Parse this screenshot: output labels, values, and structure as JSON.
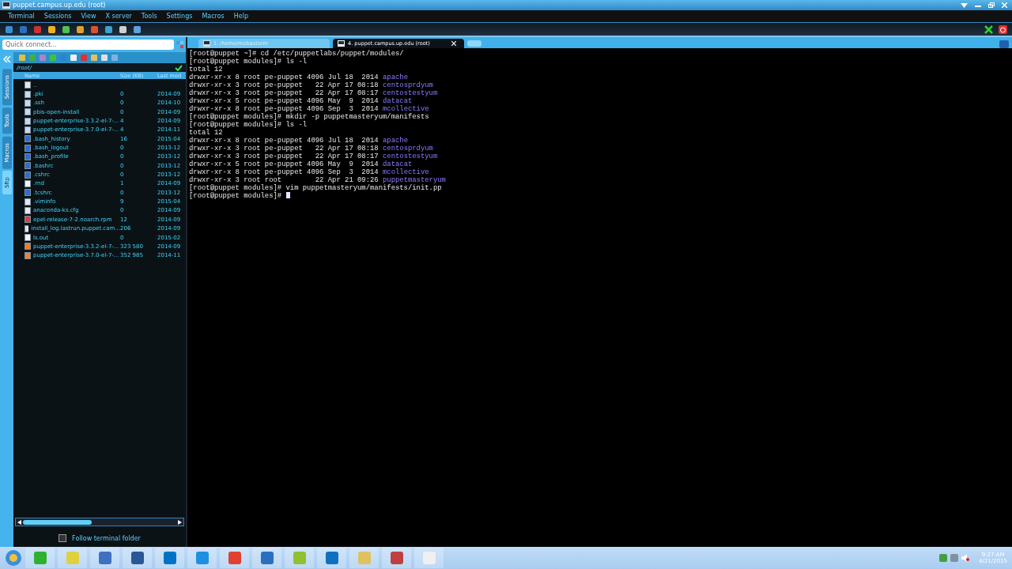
{
  "window": {
    "title": "puppet.campus.up.edu (root)"
  },
  "menu": [
    "Terminal",
    "Sessions",
    "View",
    "X server",
    "Tools",
    "Settings",
    "Macros",
    "Help"
  ],
  "quick_connect": {
    "placeholder": "Quick connect..."
  },
  "side_tabs": [
    {
      "label": "Sessions",
      "selected": false
    },
    {
      "label": "Tools",
      "selected": false
    },
    {
      "label": "Macros",
      "selected": false
    },
    {
      "label": "Sftp",
      "selected": true
    }
  ],
  "file_browser": {
    "path": "/root/",
    "columns": [
      "Name",
      "Size (KB)",
      "Last mod"
    ],
    "rows": [
      {
        "kind": "up",
        "name": "..",
        "size": "",
        "modified": ""
      },
      {
        "kind": "folder",
        "name": ".pki",
        "size": "0",
        "modified": "2014-09"
      },
      {
        "kind": "folder",
        "name": ".ssh",
        "size": "0",
        "modified": "2014-10"
      },
      {
        "kind": "folder",
        "name": "pbis-open-install",
        "size": "0",
        "modified": "2014-09"
      },
      {
        "kind": "folder",
        "name": "puppet-enterprise-3.3.2-el-7-...",
        "size": "4",
        "modified": "2014-09"
      },
      {
        "kind": "folder",
        "name": "puppet-enterprise-3.7.0-el-7-...",
        "size": "4",
        "modified": "2014-11"
      },
      {
        "kind": "config",
        "name": ".bash_history",
        "size": "16",
        "modified": "2015-04"
      },
      {
        "kind": "config",
        "name": ".bash_logout",
        "size": "0",
        "modified": "2013-12"
      },
      {
        "kind": "config",
        "name": ".bash_profile",
        "size": "0",
        "modified": "2013-12"
      },
      {
        "kind": "config",
        "name": ".bashrc",
        "size": "0",
        "modified": "2013-12"
      },
      {
        "kind": "config",
        "name": ".cshrc",
        "size": "0",
        "modified": "2013-12"
      },
      {
        "kind": "file",
        "name": ".rnd",
        "size": "1",
        "modified": "2014-09"
      },
      {
        "kind": "config",
        "name": ".tcshrc",
        "size": "0",
        "modified": "2013-12"
      },
      {
        "kind": "text",
        "name": ".viminfo",
        "size": "9",
        "modified": "2015-04"
      },
      {
        "kind": "text",
        "name": "anaconda-ks.cfg",
        "size": "0",
        "modified": "2014-09"
      },
      {
        "kind": "rpm",
        "name": "epel-release-7-2.noarch.rpm",
        "size": "12",
        "modified": "2014-09"
      },
      {
        "kind": "text",
        "name": "install_log.lastrun.puppet.cam...",
        "size": "206",
        "modified": "2014-09"
      },
      {
        "kind": "file",
        "name": "ls.out",
        "size": "0",
        "modified": "2015-02"
      },
      {
        "kind": "archive",
        "name": "puppet-enterprise-3.3.2-el-7-...",
        "size": "323 580",
        "modified": "2014-09"
      },
      {
        "kind": "archive",
        "name": "puppet-enterprise-3.7.0-el-7-...",
        "size": "352 985",
        "modified": "2014-11"
      }
    ],
    "follow_terminal_folder": {
      "label": "Follow terminal folder",
      "checked": false
    }
  },
  "tabs": [
    {
      "label": "1. /home/mobaxterm",
      "selected": false
    },
    {
      "label": "4. puppet.campus.up.edu (root)",
      "selected": true
    }
  ],
  "terminal": [
    {
      "kind": "plain",
      "text": "[root@puppet ~]# cd /etc/puppetlabs/puppet/modules/"
    },
    {
      "kind": "plain",
      "text": "[root@puppet modules]# ls -l"
    },
    {
      "kind": "plain",
      "text": "total 12"
    },
    {
      "kind": "listing",
      "text": "drwxr-xr-x 8 root pe-puppet 4096 Jul 18  2014 ",
      "name": "apache"
    },
    {
      "kind": "listing",
      "text": "drwxr-xr-x 3 root pe-puppet   22 Apr 17 08:18 ",
      "name": "centosprdyum"
    },
    {
      "kind": "listing",
      "text": "drwxr-xr-x 3 root pe-puppet   22 Apr 17 08:17 ",
      "name": "centostestyum"
    },
    {
      "kind": "listing",
      "text": "drwxr-xr-x 5 root pe-puppet 4096 May  9  2014 ",
      "name": "datacat"
    },
    {
      "kind": "listing",
      "text": "drwxr-xr-x 8 root pe-puppet 4096 Sep  3  2014 ",
      "name": "mcollective"
    },
    {
      "kind": "plain",
      "text": "[root@puppet modules]# mkdir -p puppetmasteryum/manifests"
    },
    {
      "kind": "plain",
      "text": "[root@puppet modules]# ls -l"
    },
    {
      "kind": "plain",
      "text": "total 12"
    },
    {
      "kind": "listing",
      "text": "drwxr-xr-x 8 root pe-puppet 4096 Jul 18  2014 ",
      "name": "apache"
    },
    {
      "kind": "listing",
      "text": "drwxr-xr-x 3 root pe-puppet   22 Apr 17 08:18 ",
      "name": "centosprdyum"
    },
    {
      "kind": "listing",
      "text": "drwxr-xr-x 3 root pe-puppet   22 Apr 17 08:17 ",
      "name": "centostestyum"
    },
    {
      "kind": "listing",
      "text": "drwxr-xr-x 5 root pe-puppet 4096 May  9  2014 ",
      "name": "datacat"
    },
    {
      "kind": "listing",
      "text": "drwxr-xr-x 8 root pe-puppet 4096 Sep  3  2014 ",
      "name": "mcollective"
    },
    {
      "kind": "listing",
      "text": "drwxr-xr-x 3 root root        22 Apr 21 09:26 ",
      "name": "puppetmasteryum"
    },
    {
      "kind": "plain",
      "text": "[root@puppet modules]# vim puppetmasteryum/manifests/init.pp"
    },
    {
      "kind": "cursor",
      "text": "[root@puppet modules]# "
    }
  ],
  "taskbar": {
    "time": "9:27 AM",
    "date": "4/21/2015"
  }
}
